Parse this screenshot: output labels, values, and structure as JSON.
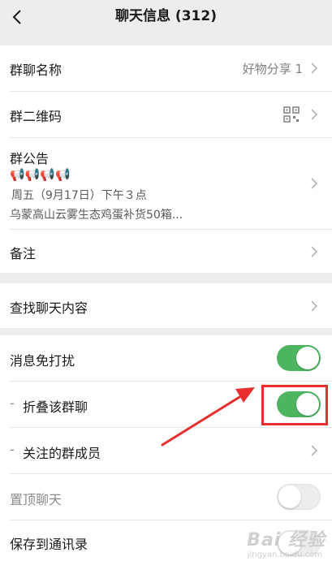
{
  "header": {
    "title": "聊天信息 (312)",
    "back_icon": "chevron-left-icon"
  },
  "group_name": {
    "label": "群聊名称",
    "value": "好物分享 1"
  },
  "qr_code": {
    "label": "群二维码",
    "icon": "qr-code-icon"
  },
  "announcement": {
    "label": "群公告",
    "emoji": "📢📢📢📢",
    "line1": "周五（9月17日）下午３点",
    "line2": "乌蒙高山云雾生态鸡蛋补货50箱..."
  },
  "remark": {
    "label": "备注"
  },
  "search_history": {
    "label": "查找聊天内容"
  },
  "mute": {
    "label": "消息免打扰",
    "on": true
  },
  "fold": {
    "prefix": "-",
    "label": "折叠该群聊",
    "on": true
  },
  "followed_members": {
    "prefix": "-",
    "label": "关注的群成员"
  },
  "pin": {
    "label": "置顶聊天",
    "on": false
  },
  "save_contacts": {
    "label": "保存到通讯录",
    "on": false
  },
  "watermark": {
    "brand": "Bai 经验",
    "sub": "jingyan.baidu.com"
  },
  "colors": {
    "toggle_on": "#4db560",
    "annotation": "#ea2e2e"
  }
}
